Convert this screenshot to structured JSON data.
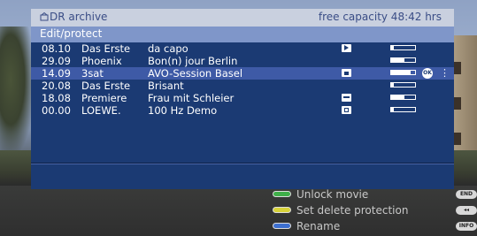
{
  "header": {
    "title": "DR archive",
    "capacity": "free capacity 48:42 hrs"
  },
  "subheader": {
    "label": "Edit/protect"
  },
  "rows": [
    {
      "time": "08.10",
      "channel": "Das Erste",
      "title": "da capo",
      "icon": "play-icon",
      "progress": 0.1,
      "selected": false
    },
    {
      "time": "29.09",
      "channel": "Phoenix",
      "title": "Bon(n) jour Berlin",
      "icon": "",
      "progress": 0.55,
      "selected": false
    },
    {
      "time": "14.09",
      "channel": "3sat",
      "title": "AVO-Session Basel",
      "icon": "lock-icon",
      "progress": 0.8,
      "selected": true
    },
    {
      "time": "20.08",
      "channel": "Das Erste",
      "title": "Brisant",
      "icon": "",
      "progress": 0.1,
      "selected": false
    },
    {
      "time": "18.08",
      "channel": "Premiere",
      "title": "Frau mit Schleier",
      "icon": "key-icon",
      "progress": 0.55,
      "selected": false
    },
    {
      "time": "00.00",
      "channel": "LOEWE.",
      "title": "100 Hz Demo",
      "icon": "delete-protect-icon",
      "progress": 0.1,
      "selected": false
    }
  ],
  "ok_label": "OK",
  "legend": [
    {
      "color": "#3fae49",
      "label": "Unlock movie",
      "key": "END"
    },
    {
      "color": "#d8d33a",
      "label": "Set delete protection",
      "key": "◂◂"
    },
    {
      "color": "#3d6fcf",
      "label": "Rename",
      "key": "INFO"
    }
  ]
}
